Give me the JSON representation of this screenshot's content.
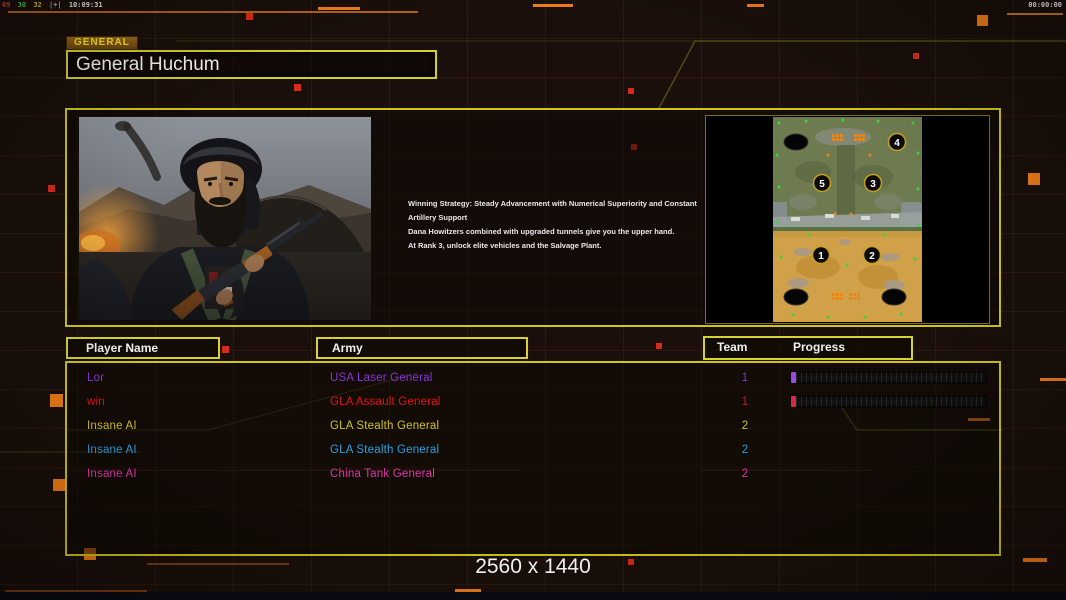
{
  "screen": {
    "resolution_label": "2560 x 1440",
    "match_timer": "00:00:00"
  },
  "debug_overlay": {
    "segments": [
      {
        "text": "09",
        "color": "#d04038"
      },
      {
        "text": "30",
        "color": "#40c840"
      },
      {
        "text": "32",
        "color": "#d0c030"
      },
      {
        "text": "|+|",
        "color": "#b0b0b0"
      },
      {
        "text": "10:09:31",
        "color": "#e8e8e8"
      }
    ]
  },
  "general_panel": {
    "tab_label": "GENERAL",
    "title": "General Huchum"
  },
  "strategy": {
    "lines": [
      "Winning Strategy: Steady Advancement with Numerical Superiority and Constant Artillery Support",
      "Dana Howitzers combined with upgraded tunnels give you the upper hand.",
      "At Rank 3, unlock elite vehicles and the Salvage Plant."
    ]
  },
  "minimap": {
    "markers": [
      "4",
      "5",
      "3",
      "1",
      "2"
    ]
  },
  "players_table": {
    "headers": {
      "player_name": "Player Name",
      "army": "Army",
      "team": "Team",
      "progress": "Progress"
    },
    "rows": [
      {
        "name": "Lor",
        "army": "USA Laser General",
        "team": "1",
        "color": "#8736d8",
        "bar_color": "#9a4ae0"
      },
      {
        "name": "win",
        "army": "GLA Assault General",
        "team": "1",
        "color": "#e11414",
        "bar_color": "#d82844"
      },
      {
        "name": "Insane AI",
        "army": "GLA Stealth General",
        "team": "2",
        "color": "#cfc22a"
      },
      {
        "name": "Insane AI",
        "army": "GLA Stealth General",
        "team": "2",
        "color": "#2aa0e4"
      },
      {
        "name": "Insane AI",
        "army": "China Tank General",
        "team": "2",
        "color": "#de35ad"
      }
    ]
  },
  "colors": {
    "panel_border": "#cfc616",
    "header_border": "#d6d22e",
    "accent_orange": "#ef7d18",
    "decor_red": "#d62a1a",
    "background": "#1a0f0a"
  }
}
